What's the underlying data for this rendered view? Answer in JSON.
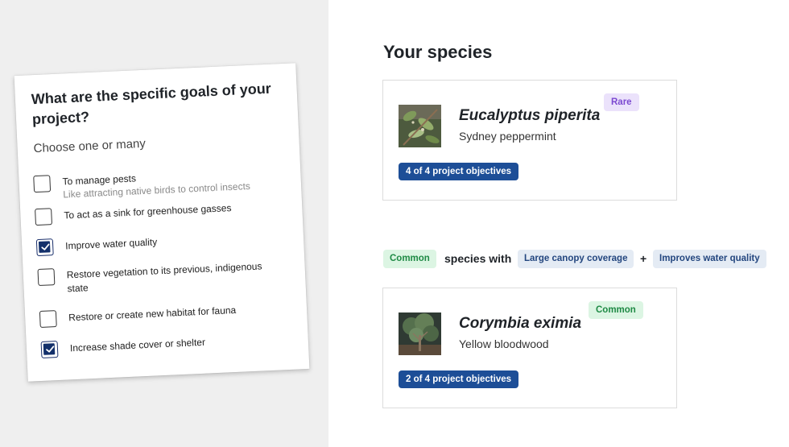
{
  "goals": {
    "title": "What are the specific goals of your project?",
    "subtitle": "Choose one or many",
    "options": [
      {
        "label": "To manage pests",
        "hint": "Like attracting native birds to control insects",
        "checked": false
      },
      {
        "label": "To act as a sink for greenhouse gasses",
        "checked": false
      },
      {
        "label": "Improve water quality",
        "checked": true
      },
      {
        "label": "Restore vegetation to its previous, indigenous state",
        "checked": false
      },
      {
        "label": "Restore or create new habitat for fauna",
        "checked": false
      },
      {
        "label": "Increase shade cover or shelter",
        "checked": true
      }
    ]
  },
  "species_section": {
    "title": "Your species",
    "top_species": {
      "scientific_name": "Eucalyptus piperita",
      "common_name": "Sydney peppermint",
      "rarity": "Rare",
      "objectives": "4 of 4 project objectives"
    },
    "filter": {
      "rarity_chip": "Common",
      "text": "species with",
      "chip_1": "Large canopy coverage",
      "plus": "+",
      "chip_2": "Improves water quality"
    },
    "bottom_species": {
      "scientific_name": "Corymbia eximia",
      "common_name": "Yellow bloodwood",
      "rarity": "Common",
      "objectives": "2 of 4 project objectives"
    }
  },
  "colors": {
    "left_background": "#efefef",
    "checkbox_checked": "#13306b",
    "objective_badge": "#1d4e97",
    "rare_badge": "#ebe2fb",
    "common_badge": "#dcf5e3",
    "filter_chip": "#e4ebf4"
  }
}
